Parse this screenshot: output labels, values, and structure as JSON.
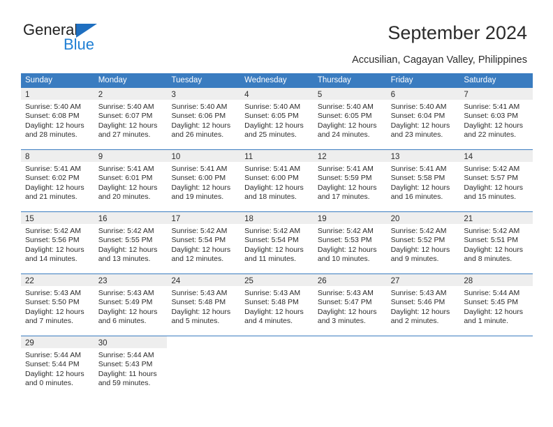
{
  "brand": {
    "name_part1": "General",
    "name_part2": "Blue",
    "triangle_icon": "triangle-icon",
    "accent_dark": "#222222",
    "accent_blue": "#1f7fd4",
    "triangle_blue": "#1f6fc0"
  },
  "header": {
    "title": "September 2024",
    "subtitle": "Accusilian, Cagayan Valley, Philippines"
  },
  "calendar": {
    "header_bg": "#3a7cc0",
    "day_band_bg": "#eeeeee",
    "weekdays": [
      "Sunday",
      "Monday",
      "Tuesday",
      "Wednesday",
      "Thursday",
      "Friday",
      "Saturday"
    ],
    "weeks": [
      [
        {
          "day": "1",
          "sunrise": "Sunrise: 5:40 AM",
          "sunset": "Sunset: 6:08 PM",
          "daylight": "Daylight: 12 hours and 28 minutes."
        },
        {
          "day": "2",
          "sunrise": "Sunrise: 5:40 AM",
          "sunset": "Sunset: 6:07 PM",
          "daylight": "Daylight: 12 hours and 27 minutes."
        },
        {
          "day": "3",
          "sunrise": "Sunrise: 5:40 AM",
          "sunset": "Sunset: 6:06 PM",
          "daylight": "Daylight: 12 hours and 26 minutes."
        },
        {
          "day": "4",
          "sunrise": "Sunrise: 5:40 AM",
          "sunset": "Sunset: 6:05 PM",
          "daylight": "Daylight: 12 hours and 25 minutes."
        },
        {
          "day": "5",
          "sunrise": "Sunrise: 5:40 AM",
          "sunset": "Sunset: 6:05 PM",
          "daylight": "Daylight: 12 hours and 24 minutes."
        },
        {
          "day": "6",
          "sunrise": "Sunrise: 5:40 AM",
          "sunset": "Sunset: 6:04 PM",
          "daylight": "Daylight: 12 hours and 23 minutes."
        },
        {
          "day": "7",
          "sunrise": "Sunrise: 5:41 AM",
          "sunset": "Sunset: 6:03 PM",
          "daylight": "Daylight: 12 hours and 22 minutes."
        }
      ],
      [
        {
          "day": "8",
          "sunrise": "Sunrise: 5:41 AM",
          "sunset": "Sunset: 6:02 PM",
          "daylight": "Daylight: 12 hours and 21 minutes."
        },
        {
          "day": "9",
          "sunrise": "Sunrise: 5:41 AM",
          "sunset": "Sunset: 6:01 PM",
          "daylight": "Daylight: 12 hours and 20 minutes."
        },
        {
          "day": "10",
          "sunrise": "Sunrise: 5:41 AM",
          "sunset": "Sunset: 6:00 PM",
          "daylight": "Daylight: 12 hours and 19 minutes."
        },
        {
          "day": "11",
          "sunrise": "Sunrise: 5:41 AM",
          "sunset": "Sunset: 6:00 PM",
          "daylight": "Daylight: 12 hours and 18 minutes."
        },
        {
          "day": "12",
          "sunrise": "Sunrise: 5:41 AM",
          "sunset": "Sunset: 5:59 PM",
          "daylight": "Daylight: 12 hours and 17 minutes."
        },
        {
          "day": "13",
          "sunrise": "Sunrise: 5:41 AM",
          "sunset": "Sunset: 5:58 PM",
          "daylight": "Daylight: 12 hours and 16 minutes."
        },
        {
          "day": "14",
          "sunrise": "Sunrise: 5:42 AM",
          "sunset": "Sunset: 5:57 PM",
          "daylight": "Daylight: 12 hours and 15 minutes."
        }
      ],
      [
        {
          "day": "15",
          "sunrise": "Sunrise: 5:42 AM",
          "sunset": "Sunset: 5:56 PM",
          "daylight": "Daylight: 12 hours and 14 minutes."
        },
        {
          "day": "16",
          "sunrise": "Sunrise: 5:42 AM",
          "sunset": "Sunset: 5:55 PM",
          "daylight": "Daylight: 12 hours and 13 minutes."
        },
        {
          "day": "17",
          "sunrise": "Sunrise: 5:42 AM",
          "sunset": "Sunset: 5:54 PM",
          "daylight": "Daylight: 12 hours and 12 minutes."
        },
        {
          "day": "18",
          "sunrise": "Sunrise: 5:42 AM",
          "sunset": "Sunset: 5:54 PM",
          "daylight": "Daylight: 12 hours and 11 minutes."
        },
        {
          "day": "19",
          "sunrise": "Sunrise: 5:42 AM",
          "sunset": "Sunset: 5:53 PM",
          "daylight": "Daylight: 12 hours and 10 minutes."
        },
        {
          "day": "20",
          "sunrise": "Sunrise: 5:42 AM",
          "sunset": "Sunset: 5:52 PM",
          "daylight": "Daylight: 12 hours and 9 minutes."
        },
        {
          "day": "21",
          "sunrise": "Sunrise: 5:42 AM",
          "sunset": "Sunset: 5:51 PM",
          "daylight": "Daylight: 12 hours and 8 minutes."
        }
      ],
      [
        {
          "day": "22",
          "sunrise": "Sunrise: 5:43 AM",
          "sunset": "Sunset: 5:50 PM",
          "daylight": "Daylight: 12 hours and 7 minutes."
        },
        {
          "day": "23",
          "sunrise": "Sunrise: 5:43 AM",
          "sunset": "Sunset: 5:49 PM",
          "daylight": "Daylight: 12 hours and 6 minutes."
        },
        {
          "day": "24",
          "sunrise": "Sunrise: 5:43 AM",
          "sunset": "Sunset: 5:48 PM",
          "daylight": "Daylight: 12 hours and 5 minutes."
        },
        {
          "day": "25",
          "sunrise": "Sunrise: 5:43 AM",
          "sunset": "Sunset: 5:48 PM",
          "daylight": "Daylight: 12 hours and 4 minutes."
        },
        {
          "day": "26",
          "sunrise": "Sunrise: 5:43 AM",
          "sunset": "Sunset: 5:47 PM",
          "daylight": "Daylight: 12 hours and 3 minutes."
        },
        {
          "day": "27",
          "sunrise": "Sunrise: 5:43 AM",
          "sunset": "Sunset: 5:46 PM",
          "daylight": "Daylight: 12 hours and 2 minutes."
        },
        {
          "day": "28",
          "sunrise": "Sunrise: 5:44 AM",
          "sunset": "Sunset: 5:45 PM",
          "daylight": "Daylight: 12 hours and 1 minute."
        }
      ],
      [
        {
          "day": "29",
          "sunrise": "Sunrise: 5:44 AM",
          "sunset": "Sunset: 5:44 PM",
          "daylight": "Daylight: 12 hours and 0 minutes."
        },
        {
          "day": "30",
          "sunrise": "Sunrise: 5:44 AM",
          "sunset": "Sunset: 5:43 PM",
          "daylight": "Daylight: 11 hours and 59 minutes."
        },
        {
          "day": "",
          "sunrise": "",
          "sunset": "",
          "daylight": ""
        },
        {
          "day": "",
          "sunrise": "",
          "sunset": "",
          "daylight": ""
        },
        {
          "day": "",
          "sunrise": "",
          "sunset": "",
          "daylight": ""
        },
        {
          "day": "",
          "sunrise": "",
          "sunset": "",
          "daylight": ""
        },
        {
          "day": "",
          "sunrise": "",
          "sunset": "",
          "daylight": ""
        }
      ]
    ]
  }
}
